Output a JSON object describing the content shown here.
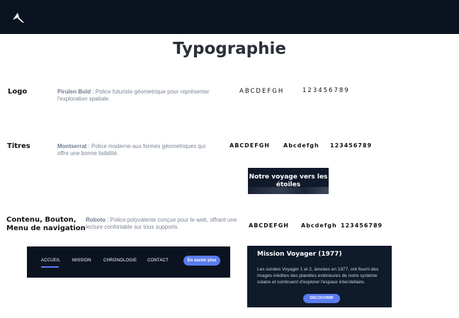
{
  "header": {
    "logo_icon": "arrow-logo-icon"
  },
  "page_title": "Typographie",
  "rows": {
    "logo": {
      "label": "Logo",
      "font_name": "Pirulen Bold",
      "description": " : Police futuriste géometrique pour représenter l'exploration spatiale.",
      "sample_letters": "ABCDEFGH",
      "sample_numbers": "123456789"
    },
    "titres": {
      "label": "Titres",
      "font_name": "Montserrat",
      "description": " : Police moderne aux formes géometriques qui offre une bonne lisibilité.",
      "sample_upper": "ABCDEFGH",
      "sample_mixed": "Abcdefgh",
      "sample_numbers": "123456789",
      "banner_text": "Notre voyage vers les étoiles"
    },
    "contenu": {
      "label_line1": "Contenu, Bouton,",
      "label_line2": "Menu de navigation",
      "font_name": "Roboto",
      "description": " : Police polyvalente conçue pour le web, offrant une lecture confortable sur tous supports.",
      "sample_upper": "ABCDEFGH",
      "sample_mixed": "Abcdefgh",
      "sample_numbers": "123456789"
    }
  },
  "nav": {
    "items": [
      "ACCUEIL",
      "MISSION",
      "CHRONOLOGIE",
      "CONTACT"
    ],
    "cta": "En savoir plus",
    "accent": "#5b7cf0"
  },
  "card": {
    "title": "Mission Voyager (1977)",
    "body": "Les sondes Voyager 1 et 2, lancées en 1977, ont fourni des images inédites des planètes extérieures de notre système solaire et continuent d'explorer l'espace interstellaire.",
    "button": "DÉCOUVRIR"
  },
  "colors": {
    "dark_bg": "#0b1320",
    "accent": "#5b7cf0"
  }
}
